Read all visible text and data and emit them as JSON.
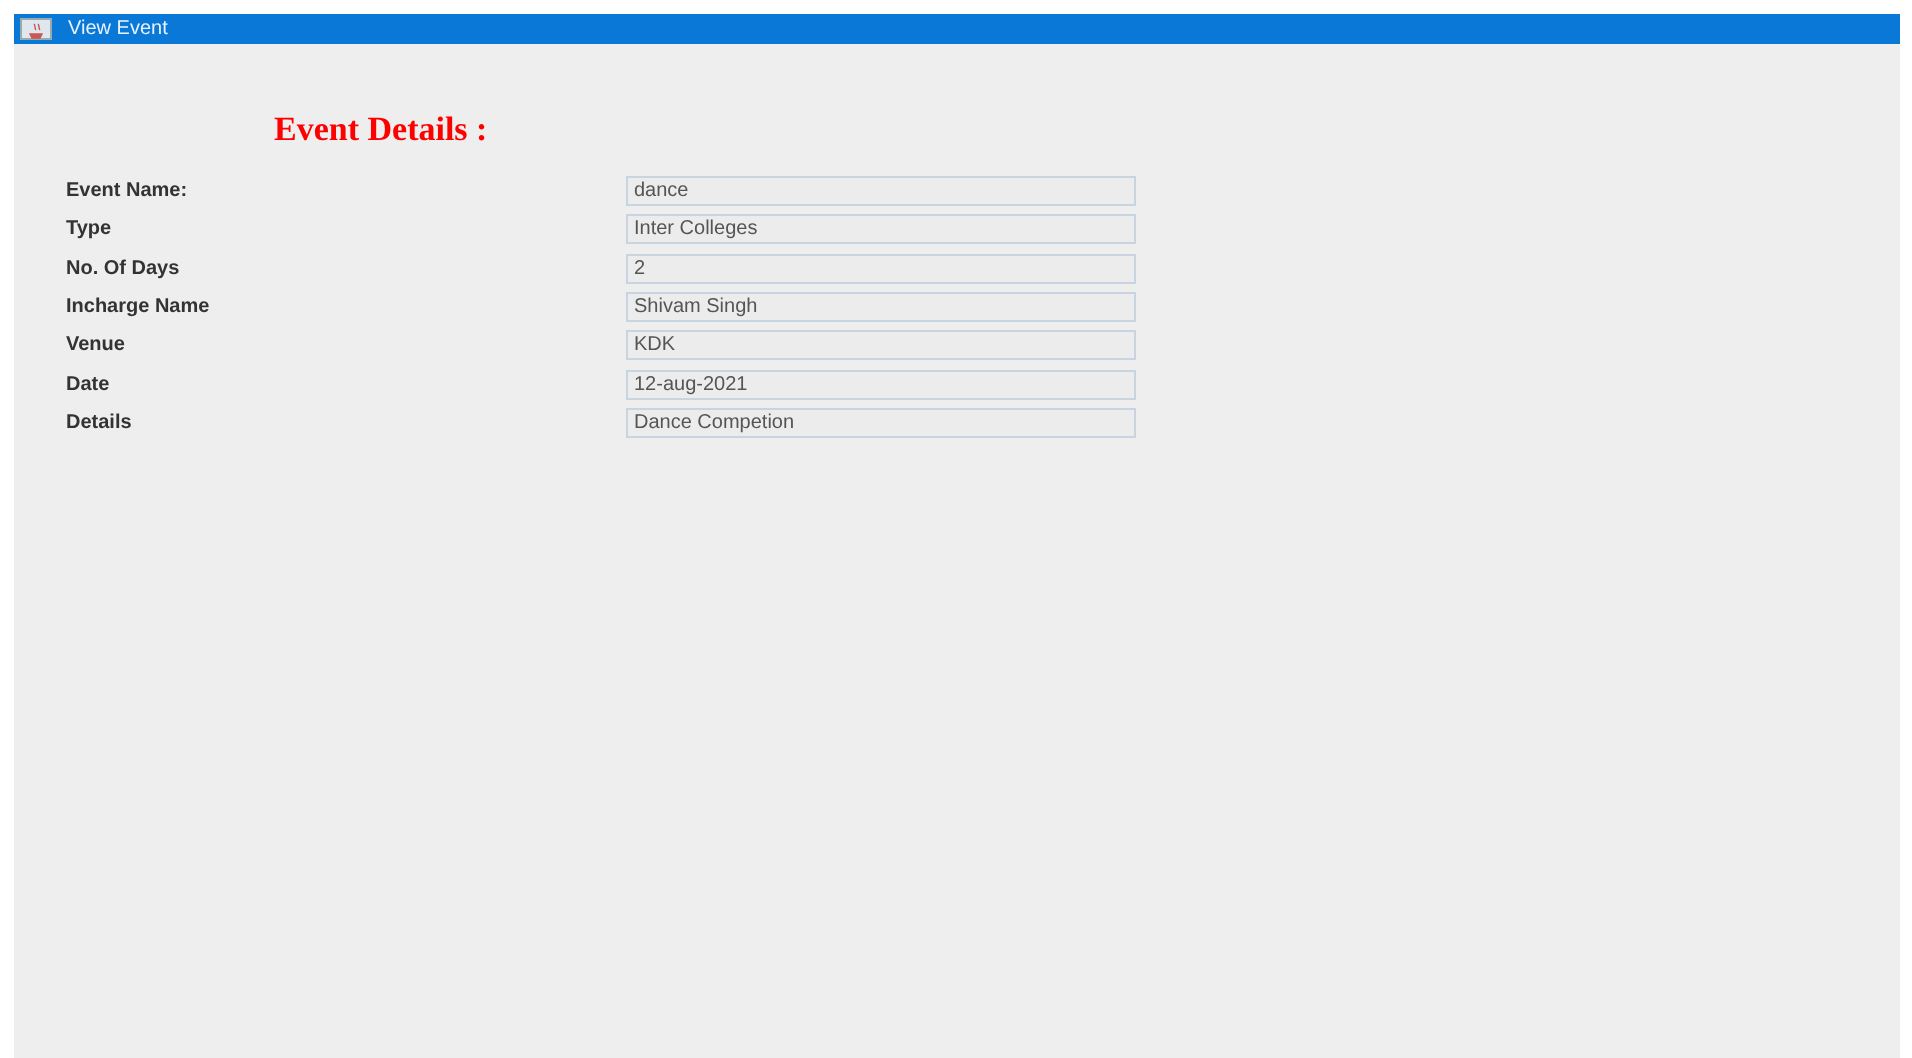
{
  "window": {
    "title": "View Event"
  },
  "heading": "Event Details :",
  "fields": [
    {
      "label": "Event Name:",
      "value": "dance"
    },
    {
      "label": "Type",
      "value": "Inter Colleges"
    },
    {
      "label": "No. Of Days",
      "value": "2"
    },
    {
      "label": "Incharge Name",
      "value": "Shivam Singh"
    },
    {
      "label": "Venue",
      "value": "KDK"
    },
    {
      "label": "Date",
      "value": "12-aug-2021"
    },
    {
      "label": "Details",
      "value": "Dance Competion"
    }
  ]
}
